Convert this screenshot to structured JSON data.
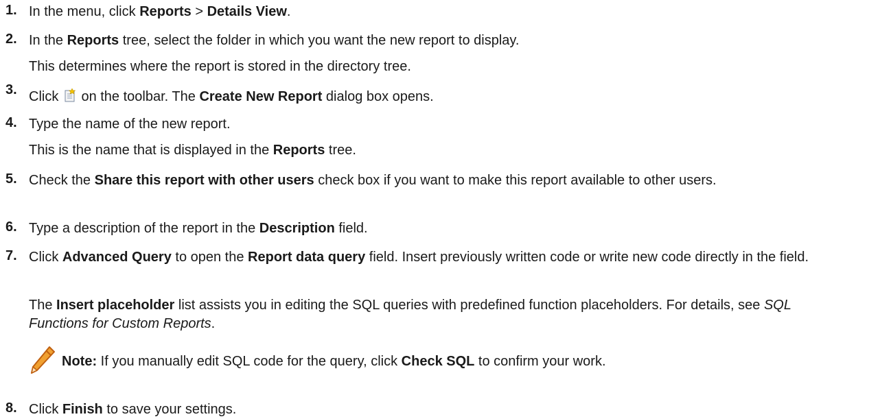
{
  "steps": [
    {
      "number": "1.",
      "parts": [
        "In the menu, click ",
        "Reports",
        " > ",
        "Details View",
        "."
      ]
    },
    {
      "number": "2.",
      "parts": [
        "In the ",
        "Reports",
        " tree, select the folder in which you want the new report to display."
      ],
      "sub": "This determines where the report is stored in the directory tree."
    },
    {
      "number": "3.",
      "parts": [
        "Click ",
        " on the toolbar. The ",
        "Create New Report",
        " dialog box opens."
      ],
      "icon": "new-report-icon"
    },
    {
      "number": "4.",
      "parts": [
        "Type the name of the new report."
      ],
      "sub_parts": [
        "This is the name that is displayed in the ",
        "Reports",
        " tree."
      ]
    },
    {
      "number": "5.",
      "parts": [
        "Check the ",
        "Share this report with other users",
        " check box if you want to make this report available to other users."
      ]
    },
    {
      "number": "6.",
      "parts": [
        "Type a description of the report in the ",
        "Description",
        " field."
      ]
    },
    {
      "number": "7.",
      "parts": [
        "Click ",
        "Advanced Query",
        " to open the ",
        "Report data query",
        " field. Insert previously written code or write new code directly in the field."
      ],
      "sub_parts": [
        "The ",
        "Insert placeholder",
        " list assists you in editing the SQL queries with predefined function placeholders. For details, see ",
        "SQL Functions for Custom Reports",
        "."
      ],
      "note": {
        "icon": "pencil-icon",
        "label": "Note:",
        "parts": [
          " If you manually edit SQL code for the query, click ",
          "Check SQL",
          " to confirm your work."
        ]
      }
    },
    {
      "number": "8.",
      "parts": [
        "Click ",
        "Finish",
        " to save your settings."
      ]
    }
  ],
  "colors": {
    "text": "#1a1a1a",
    "pencil_body": "#f0a030",
    "pencil_outline": "#c06010"
  }
}
